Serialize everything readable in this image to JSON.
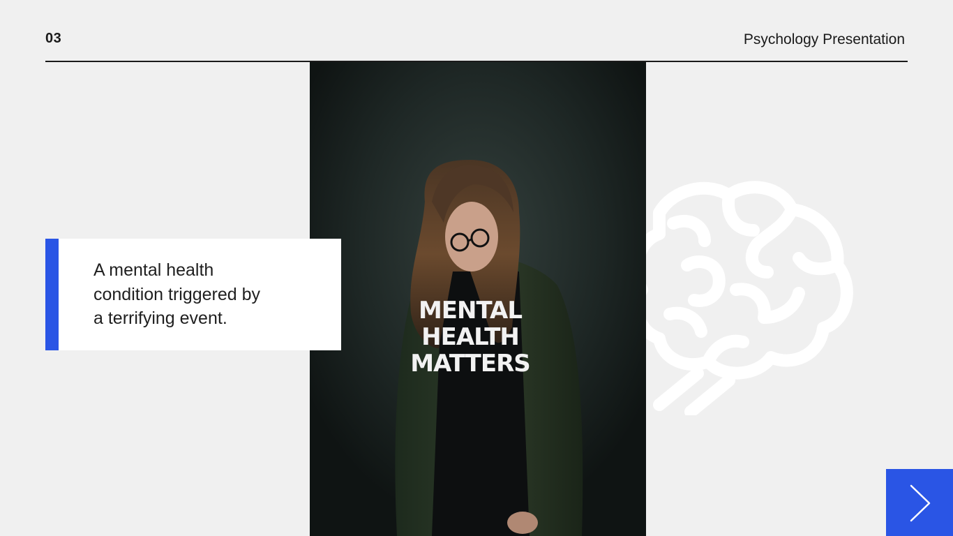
{
  "slide": {
    "number": "03",
    "title": "Psychology Presentation"
  },
  "caption": {
    "text": "A mental health\ncondition  triggered by\na terrifying event."
  },
  "photo": {
    "shirt_lines": [
      "MENTAL",
      "HEALTH",
      "MATTERS"
    ]
  },
  "icons": {
    "decorative": "brain-icon",
    "next": "chevron-right-icon"
  },
  "colors": {
    "accent": "#2a55e5",
    "background": "#f0f0f0",
    "text": "#1a1a1a"
  }
}
